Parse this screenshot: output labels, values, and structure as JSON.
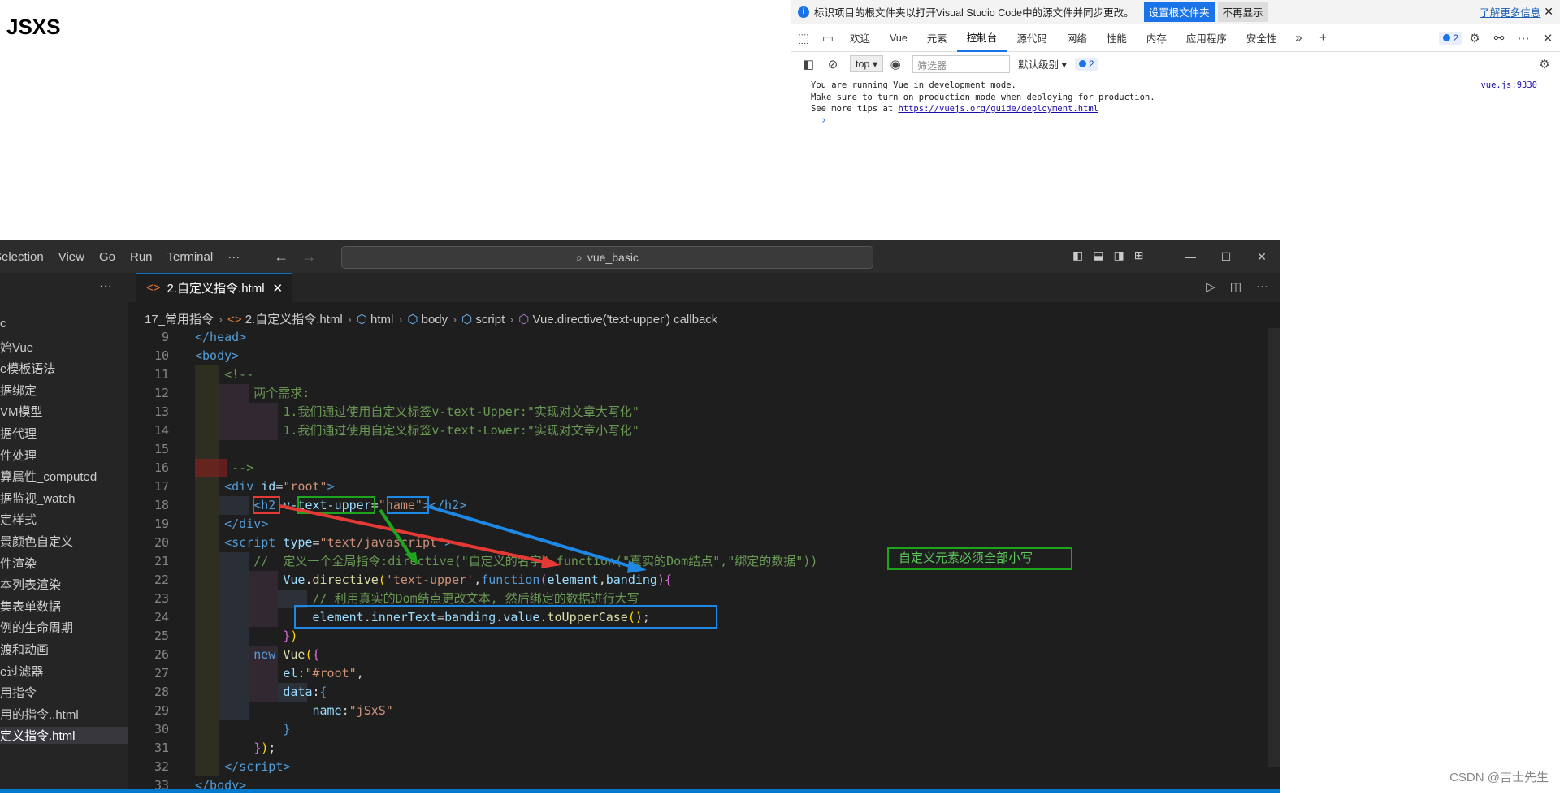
{
  "page": {
    "heading": "JSXS"
  },
  "devtools": {
    "info": {
      "text": "标识项目的根文件夹以打开Visual Studio Code中的源文件并同步更改。",
      "primary": "设置根文件夹",
      "secondary": "不再显示",
      "learn_more": "了解更多信息",
      "close": "✕"
    },
    "tabs": [
      "欢迎",
      "Vue",
      "元素",
      "控制台",
      "源代码",
      "网络",
      "性能",
      "内存",
      "应用程序",
      "安全性"
    ],
    "active_tab": "控制台",
    "issue_count": "2",
    "toolbar": {
      "context": "top",
      "filter_placeholder": "筛选器",
      "level": "默认级别",
      "badge": "2"
    },
    "console": {
      "lines": [
        "You are running Vue in development mode.",
        "Make sure to turn on production mode when deploying for production.",
        "See more tips at "
      ],
      "link": "https://vuejs.org/guide/deployment.html",
      "source": "vue.js:9330",
      "prompt": "›"
    }
  },
  "vscode": {
    "menu": [
      "Selection",
      "View",
      "Go",
      "Run",
      "Terminal",
      "···"
    ],
    "search": "vue_basic",
    "tab": "2.自定义指令.html",
    "breadcrumb": [
      "17_常用指令",
      "2.自定义指令.html",
      "html",
      "body",
      "script",
      "Vue.directive('text-upper') callback"
    ],
    "sidebar": [
      "c",
      "始Vue",
      "e模板语法",
      "据绑定",
      "VM模型",
      "据代理",
      "件处理",
      "算属性_computed",
      "据监视_watch",
      "定样式",
      "景颜色自定义",
      "件渲染",
      "本列表渲染",
      "集表单数据",
      "例的生命周期",
      "渡和动画",
      "e过滤器",
      "用指令",
      "用的指令..html",
      "定义指令.html"
    ],
    "line_numbers": [
      "9",
      "10",
      "11",
      "12",
      "13",
      "14",
      "15",
      "16",
      "17",
      "18",
      "19",
      "20",
      "21",
      "22",
      "23",
      "24",
      "25",
      "26",
      "27",
      "28",
      "29",
      "30",
      "31",
      "32",
      "33"
    ],
    "annotation": "自定义元素必须全部小写",
    "colors": {
      "red_box": "#e53935",
      "green_box": "#1ea51e",
      "blue_box": "#1e88e5"
    }
  },
  "watermark": "CSDN @吉士先生"
}
